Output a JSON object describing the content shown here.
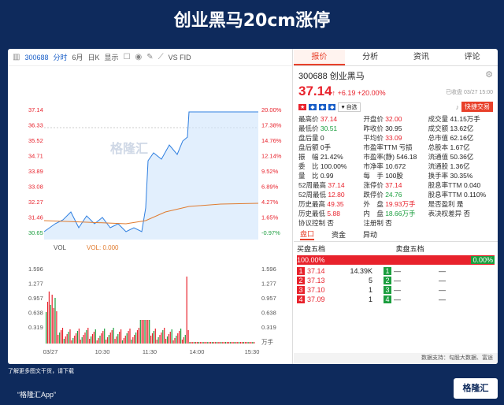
{
  "title": "创业黑马20cm涨停",
  "toolbar": {
    "code": "300688",
    "period": "分时",
    "month": "6月",
    "kline": "日K",
    "show": "显示",
    "vs": "VS FID"
  },
  "tabs": [
    "报价",
    "分析",
    "资讯",
    "评论"
  ],
  "stock": {
    "code": "300688",
    "name": "创业黑马",
    "price": "37.14",
    "arrow": "↑",
    "chg": "+6.19",
    "pct": "+20.00%",
    "status": "已收盘 03/27 15:00",
    "btn_add": "自选",
    "btn_trade": "快捷交易"
  },
  "quote": [
    [
      "最高价",
      "37.14",
      "开盘价",
      "32.00",
      "成交量",
      "41.15万手"
    ],
    [
      "最低价",
      "30.51",
      "昨收价",
      "30.95",
      "成交额",
      "13.62亿"
    ],
    [
      "盘后量",
      "0",
      "平均价",
      "33.09",
      "总市值",
      "62.16亿"
    ],
    [
      "盘后额",
      "0手",
      "市盈率TTM",
      "亏损",
      "总股本",
      "1.67亿"
    ],
    [
      "振　幅",
      "21.42%",
      "市盈率(静)",
      "546.18",
      "流通值",
      "50.36亿"
    ],
    [
      "委　比",
      "100.00%",
      "市净率",
      "10.672",
      "流通股",
      "1.36亿"
    ],
    [
      "量　比",
      "0.99",
      "每　手",
      "100股",
      "换手率",
      "30.35%"
    ],
    [
      "52周最高",
      "37.14",
      "涨停价",
      "37.14",
      "股息率TTM",
      "0.040"
    ],
    [
      "52周最低",
      "12.80",
      "跌停价",
      "24.76",
      "股息率TTM",
      "0.110%"
    ],
    [
      "历史最高",
      "49.35",
      "外　盘",
      "19.93万手",
      "是否盈利",
      "是"
    ],
    [
      "历史最低",
      "5.88",
      "内　盘",
      "18.66万手",
      "表决权差异",
      "否"
    ],
    [
      "协议控制",
      "否",
      "注册制",
      "否",
      "",
      ""
    ]
  ],
  "subtabs": [
    "盘口",
    "资金",
    "异动"
  ],
  "orderbook": {
    "buy_label": "买盘五档",
    "sell_label": "卖盘五档",
    "buy_pct": "100.00%",
    "sell_pct": "0.00%",
    "rows": [
      [
        "1",
        "37.14",
        "14.39K",
        "1",
        "—",
        "—"
      ],
      [
        "2",
        "37.13",
        "5",
        "2",
        "—",
        "—"
      ],
      [
        "3",
        "37.10",
        "1",
        "3",
        "—",
        "—"
      ],
      [
        "4",
        "37.09",
        "1",
        "4",
        "—",
        "—"
      ]
    ]
  },
  "footer": "数据支持：勾股大数据、富途",
  "chart": {
    "yleft": [
      "37.14",
      "36.33",
      "35.52",
      "34.71",
      "33.89",
      "33.08",
      "32.27",
      "31.46",
      "30.65"
    ],
    "yright": [
      "20.00%",
      "17.38%",
      "14.76%",
      "12.14%",
      "9.52%",
      "6.89%",
      "4.27%",
      "1.65%",
      "-0.97%"
    ],
    "vol_left": [
      "1.596",
      "1.277",
      "0.957",
      "0.638",
      "0.319"
    ],
    "vol_right": [
      "1.596",
      "1.277",
      "0.957",
      "0.638",
      "0.319",
      "万手"
    ],
    "xlabels": [
      "03/27",
      "10:30",
      "11:30",
      "14:00",
      "15:30"
    ],
    "vol_label": "VOL",
    "vol_val": "VOL: 0.000"
  },
  "note": "了解更多图文干货，请下载",
  "app": "“格隆汇App”",
  "logo": "格隆汇",
  "watermark": "格隆汇"
}
